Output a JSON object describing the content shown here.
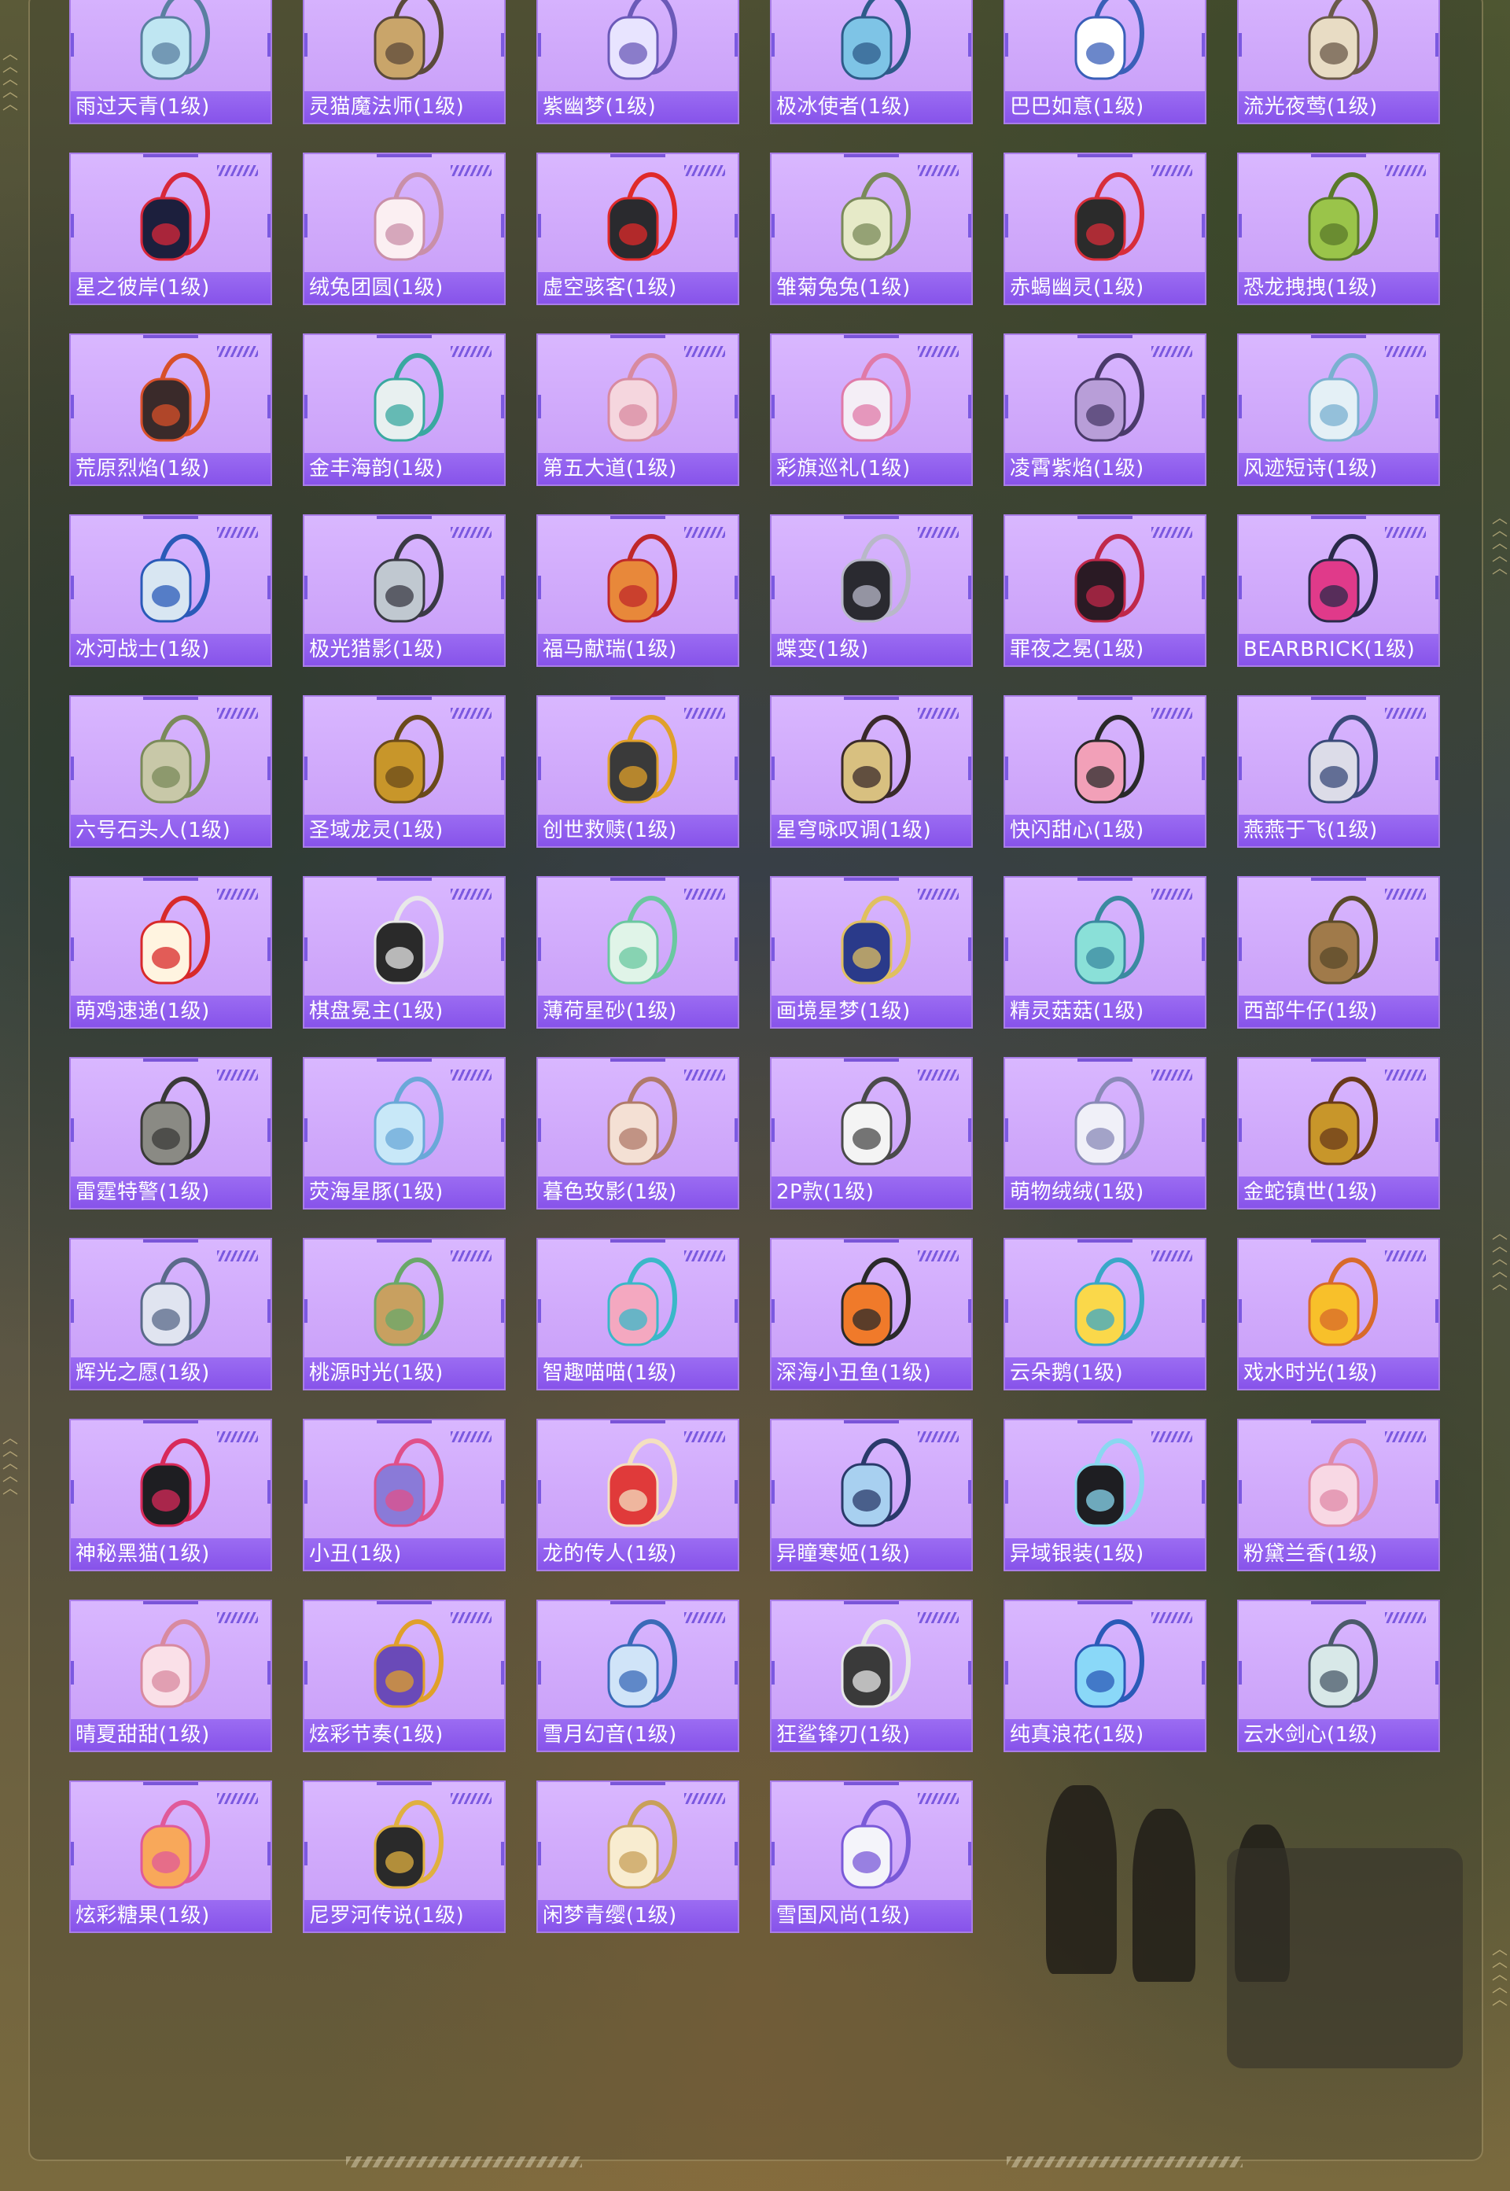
{
  "colors": {
    "card_bg": "#d4adff",
    "label_bg": "#8f5eee",
    "accent": "#7b59e0",
    "label_text": "#ffffff"
  },
  "items": [
    {
      "name": "雨过天青(1级)",
      "main": "#bfe6f2",
      "accent": "#5a7fa0",
      "icon": "bag-icon"
    },
    {
      "name": "灵猫魔法师(1级)",
      "main": "#c9a56a",
      "accent": "#5b4a3a",
      "icon": "bag-icon"
    },
    {
      "name": "紫幽梦(1级)",
      "main": "#e8e4ff",
      "accent": "#6b5ab8",
      "icon": "bag-icon"
    },
    {
      "name": "极冰使者(1级)",
      "main": "#7ec4e6",
      "accent": "#2e5b8a",
      "icon": "bag-icon"
    },
    {
      "name": "巴巴如意(1级)",
      "main": "#ffffff",
      "accent": "#3a5fb8",
      "icon": "bag-icon"
    },
    {
      "name": "流光夜莺(1级)",
      "main": "#e8dcc4",
      "accent": "#6b5a4a",
      "icon": "bag-icon"
    },
    {
      "name": "星之彼岸(1级)",
      "main": "#1c1f3d",
      "accent": "#d8283a",
      "icon": "bag-icon"
    },
    {
      "name": "绒兔团圆(1级)",
      "main": "#fbeff2",
      "accent": "#c98fa8",
      "icon": "bag-icon"
    },
    {
      "name": "虚空骇客(1级)",
      "main": "#2a2a2e",
      "accent": "#e02a2a",
      "icon": "bag-icon"
    },
    {
      "name": "雏菊兔兔(1级)",
      "main": "#e6eac8",
      "accent": "#7a8a5a",
      "icon": "bag-icon"
    },
    {
      "name": "赤蝎幽灵(1级)",
      "main": "#2b2b2b",
      "accent": "#d82e3a",
      "icon": "bag-icon"
    },
    {
      "name": "恐龙拽拽(1级)",
      "main": "#9ac44a",
      "accent": "#5a7a2a",
      "icon": "bag-icon"
    },
    {
      "name": "荒原烈焰(1级)",
      "main": "#3a2a2a",
      "accent": "#d8502a",
      "icon": "bag-icon"
    },
    {
      "name": "金丰海韵(1级)",
      "main": "#e8f0f0",
      "accent": "#3aa8a0",
      "icon": "bag-icon"
    },
    {
      "name": "第五大道(1级)",
      "main": "#f5d6de",
      "accent": "#d88aa0",
      "icon": "bag-icon"
    },
    {
      "name": "彩旗巡礼(1级)",
      "main": "#f4eef6",
      "accent": "#e07aa8",
      "icon": "bag-icon"
    },
    {
      "name": "凌霄紫焰(1级)",
      "main": "#b89ed8",
      "accent": "#4a3a6a",
      "icon": "bag-icon"
    },
    {
      "name": "风迹短诗(1级)",
      "main": "#e4f0f6",
      "accent": "#7ab0d0",
      "icon": "bag-icon"
    },
    {
      "name": "冰河战士(1级)",
      "main": "#d8e6f2",
      "accent": "#2a5ab8",
      "icon": "bag-icon"
    },
    {
      "name": "极光猎影(1级)",
      "main": "#c0c8d0",
      "accent": "#3a3a44",
      "icon": "bag-icon"
    },
    {
      "name": "福马献瑞(1级)",
      "main": "#e8883a",
      "accent": "#c0282a",
      "icon": "bag-icon"
    },
    {
      "name": "蝶变(1级)",
      "main": "#2a2a30",
      "accent": "#b8b8c8",
      "icon": "bag-icon"
    },
    {
      "name": "罪夜之冕(1级)",
      "main": "#2a1a24",
      "accent": "#c0284a",
      "icon": "bag-icon"
    },
    {
      "name": "BEARBRICK(1级)",
      "main": "#e03a8a",
      "accent": "#2a2a4a",
      "icon": "bag-icon"
    },
    {
      "name": "六号石头人(1级)",
      "main": "#c8c8a8",
      "accent": "#7a8a5a",
      "icon": "bag-icon"
    },
    {
      "name": "圣域龙灵(1级)",
      "main": "#c8962a",
      "accent": "#6a4a1a",
      "icon": "bag-icon"
    },
    {
      "name": "创世救赎(1级)",
      "main": "#3a3a3a",
      "accent": "#e0a02a",
      "icon": "bag-icon"
    },
    {
      "name": "星穹咏叹调(1级)",
      "main": "#d8c080",
      "accent": "#3a2a2a",
      "icon": "bag-icon"
    },
    {
      "name": "快闪甜心(1级)",
      "main": "#f2a0b8",
      "accent": "#2a2a2a",
      "icon": "bag-icon"
    },
    {
      "name": "燕燕于飞(1级)",
      "main": "#dcdce8",
      "accent": "#3a4a7a",
      "icon": "bag-icon"
    },
    {
      "name": "萌鸡速递(1级)",
      "main": "#fff4e0",
      "accent": "#d82a2a",
      "icon": "bag-icon"
    },
    {
      "name": "棋盘冕主(1级)",
      "main": "#2a2a2a",
      "accent": "#e8e8e8",
      "icon": "bag-icon"
    },
    {
      "name": "薄荷星砂(1级)",
      "main": "#e0f4e8",
      "accent": "#6ac8a0",
      "icon": "bag-icon"
    },
    {
      "name": "画境星梦(1级)",
      "main": "#2a3a8a",
      "accent": "#e0c060",
      "icon": "bag-icon"
    },
    {
      "name": "精灵菇菇(1级)",
      "main": "#8ae0d8",
      "accent": "#3a8aa0",
      "icon": "bag-icon"
    },
    {
      "name": "西部牛仔(1级)",
      "main": "#a07a4a",
      "accent": "#5a4a2a",
      "icon": "bag-icon"
    },
    {
      "name": "雷霆特警(1级)",
      "main": "#8a8a84",
      "accent": "#3a3a38",
      "icon": "bag-icon"
    },
    {
      "name": "荧海星豚(1级)",
      "main": "#c8e8f8",
      "accent": "#6aa8d8",
      "icon": "bag-icon"
    },
    {
      "name": "暮色玫影(1级)",
      "main": "#f4e0d4",
      "accent": "#b07a6a",
      "icon": "bag-icon"
    },
    {
      "name": "2P款(1级)",
      "main": "#f4f4f4",
      "accent": "#4a4a4a",
      "icon": "bag-icon"
    },
    {
      "name": "萌物绒绒(1级)",
      "main": "#f0f0f8",
      "accent": "#8a8ab8",
      "icon": "bag-icon"
    },
    {
      "name": "金蛇镇世(1级)",
      "main": "#c8962a",
      "accent": "#6a3a1a",
      "icon": "bag-icon"
    },
    {
      "name": "辉光之愿(1级)",
      "main": "#e0e4f0",
      "accent": "#5a6a8a",
      "icon": "bag-icon"
    },
    {
      "name": "桃源时光(1级)",
      "main": "#c8a060",
      "accent": "#6aa86a",
      "icon": "bag-icon"
    },
    {
      "name": "智趣喵喵(1级)",
      "main": "#f4a8c0",
      "accent": "#3ab8c8",
      "icon": "bag-icon"
    },
    {
      "name": "深海小丑鱼(1级)",
      "main": "#f07a2a",
      "accent": "#2a2a2a",
      "icon": "bag-icon"
    },
    {
      "name": "云朵鹅(1级)",
      "main": "#fad84a",
      "accent": "#3aa8c8",
      "icon": "bag-icon"
    },
    {
      "name": "戏水时光(1级)",
      "main": "#f8c02a",
      "accent": "#d86a2a",
      "icon": "bag-icon"
    },
    {
      "name": "神秘黑猫(1级)",
      "main": "#1e1e22",
      "accent": "#d82a5a",
      "icon": "bag-icon"
    },
    {
      "name": "小丑(1级)",
      "main": "#8a7ad8",
      "accent": "#e0508a",
      "icon": "bag-icon"
    },
    {
      "name": "龙的传人(1级)",
      "main": "#e03a3a",
      "accent": "#f4e0c0",
      "icon": "bag-icon"
    },
    {
      "name": "异瞳寒姬(1级)",
      "main": "#a8d0f0",
      "accent": "#2a3a6a",
      "icon": "bag-icon"
    },
    {
      "name": "异域银装(1级)",
      "main": "#1e1e22",
      "accent": "#8ad8f0",
      "icon": "bag-icon"
    },
    {
      "name": "粉黛兰香(1级)",
      "main": "#f8d8e4",
      "accent": "#e08aa8",
      "icon": "bag-icon"
    },
    {
      "name": "晴夏甜甜(1级)",
      "main": "#fae0e8",
      "accent": "#d88aa0",
      "icon": "bag-icon"
    },
    {
      "name": "炫彩节奏(1级)",
      "main": "#6a4ab8",
      "accent": "#e0a02a",
      "icon": "bag-icon"
    },
    {
      "name": "雪月幻音(1级)",
      "main": "#d0e4f8",
      "accent": "#3a6ab8",
      "icon": "bag-icon"
    },
    {
      "name": "狂鲨锋刃(1级)",
      "main": "#3a3a3a",
      "accent": "#e8e8e8",
      "icon": "bag-icon"
    },
    {
      "name": "纯真浪花(1级)",
      "main": "#8ad8f8",
      "accent": "#2a5ab8",
      "icon": "bag-icon"
    },
    {
      "name": "云水剑心(1级)",
      "main": "#d8e8e8",
      "accent": "#4a5a6a",
      "icon": "bag-icon"
    },
    {
      "name": "炫彩糖果(1级)",
      "main": "#f8a85a",
      "accent": "#e05a9a",
      "icon": "bag-icon"
    },
    {
      "name": "尼罗河传说(1级)",
      "main": "#2a2a2a",
      "accent": "#e0b040",
      "icon": "bag-icon"
    },
    {
      "name": "闲梦青缨(1级)",
      "main": "#f8ecd0",
      "accent": "#c8a05a",
      "icon": "bag-icon"
    },
    {
      "name": "雪国风尚(1级)",
      "main": "#f4f4fa",
      "accent": "#7a5ad8",
      "icon": "bag-icon"
    }
  ]
}
